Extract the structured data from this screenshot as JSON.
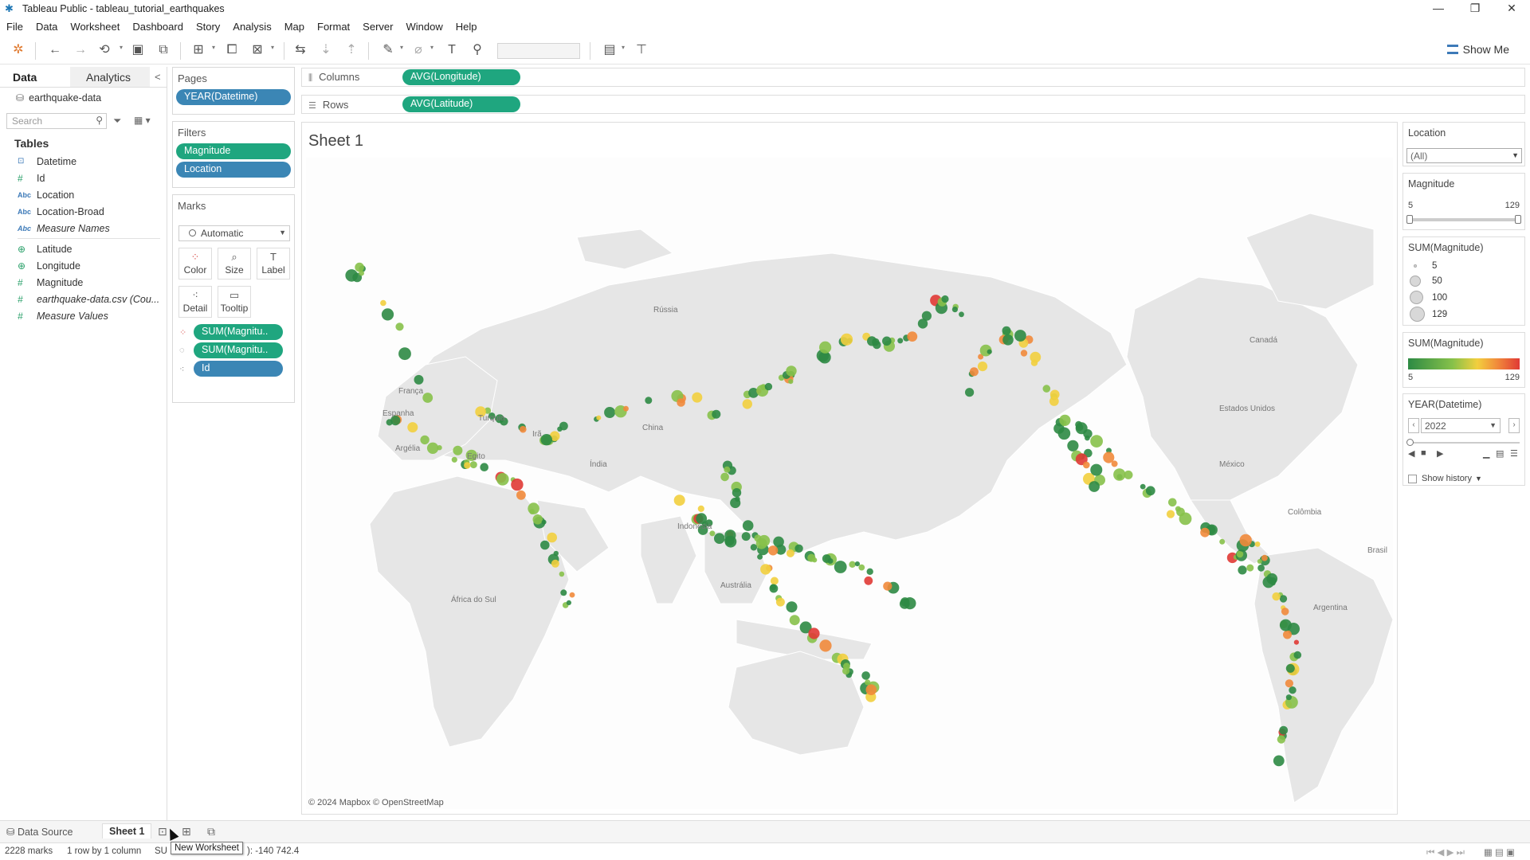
{
  "window": {
    "title": "Tableau Public - tableau_tutorial_earthquakes",
    "controls": [
      "—",
      "❐",
      "✕"
    ]
  },
  "menu": [
    "File",
    "Data",
    "Worksheet",
    "Dashboard",
    "Story",
    "Analysis",
    "Map",
    "Format",
    "Server",
    "Window",
    "Help"
  ],
  "toolbar": {
    "show_me": "Show Me"
  },
  "data_pane": {
    "tabs": [
      "Data",
      "Analytics"
    ],
    "collapse": "<",
    "datasource": "earthquake-data",
    "search_placeholder": "Search",
    "tables_heading": "Tables",
    "fields": [
      {
        "label": "Datetime",
        "type": "date",
        "icon": "⊡"
      },
      {
        "label": "Id",
        "type": "num",
        "icon": "#"
      },
      {
        "label": "Location",
        "type": "abc",
        "icon": "Abc"
      },
      {
        "label": "Location-Broad",
        "type": "abc",
        "icon": "Abc"
      },
      {
        "label": "Measure Names",
        "type": "abc",
        "icon": "Abc",
        "italic": true
      }
    ],
    "measures": [
      {
        "label": "Latitude",
        "type": "geo",
        "icon": "⊕"
      },
      {
        "label": "Longitude",
        "type": "geo",
        "icon": "⊕"
      },
      {
        "label": "Magnitude",
        "type": "num",
        "icon": "#"
      },
      {
        "label": "earthquake-data.csv (Cou...",
        "type": "num",
        "icon": "#",
        "italic": true
      },
      {
        "label": "Measure Values",
        "type": "num",
        "icon": "#",
        "italic": true
      }
    ]
  },
  "pages": {
    "heading": "Pages",
    "pill": "YEAR(Datetime)"
  },
  "filters": {
    "heading": "Filters",
    "pills": [
      "Magnitude",
      "Location"
    ]
  },
  "marks": {
    "heading": "Marks",
    "type": "Automatic",
    "buttons": [
      "Color",
      "Size",
      "Label",
      "Detail",
      "Tooltip"
    ],
    "pills": [
      "SUM(Magnitu..",
      "SUM(Magnitu..",
      "Id"
    ]
  },
  "shelves": {
    "columns_label": "Columns",
    "columns_pill": "AVG(Longitude)",
    "rows_label": "Rows",
    "rows_pill": "AVG(Latitude)"
  },
  "view": {
    "sheet_title": "Sheet 1",
    "attribution": "© 2024 Mapbox © OpenStreetMap",
    "map_labels": [
      "Rússia",
      "Canadá",
      "França",
      "Espanha",
      "Argélia",
      "Egito",
      "Turquia",
      "Irã",
      "China",
      "Índia",
      "Indonésia",
      "Austrália",
      "África do Sul",
      "Estados Unidos",
      "México",
      "Colômbia",
      "Brasil",
      "Argentina"
    ]
  },
  "legends": {
    "location": {
      "title": "Location",
      "value": "(All)"
    },
    "magnitude": {
      "title": "Magnitude",
      "min": "5",
      "max": "129"
    },
    "size": {
      "title": "SUM(Magnitude)",
      "entries": [
        "5",
        "50",
        "100",
        "129"
      ]
    },
    "color": {
      "title": "SUM(Magnitude)",
      "min": "5",
      "max": "129",
      "colors": [
        "#2d8a44",
        "#87c14a",
        "#f2cf3e",
        "#f18a3b",
        "#e03a35"
      ]
    },
    "year": {
      "title": "YEAR(Datetime)",
      "value": "2022",
      "show_history": "Show history"
    }
  },
  "bottom": {
    "data_source": "Data Source",
    "sheet_tab": "Sheet 1",
    "tooltip": "New Worksheet",
    "status_marks": "2228 marks",
    "status_rows": "1 row by 1 column",
    "status_sum_prefix": "SU",
    "status_sum_value": "): -140 742.4"
  }
}
